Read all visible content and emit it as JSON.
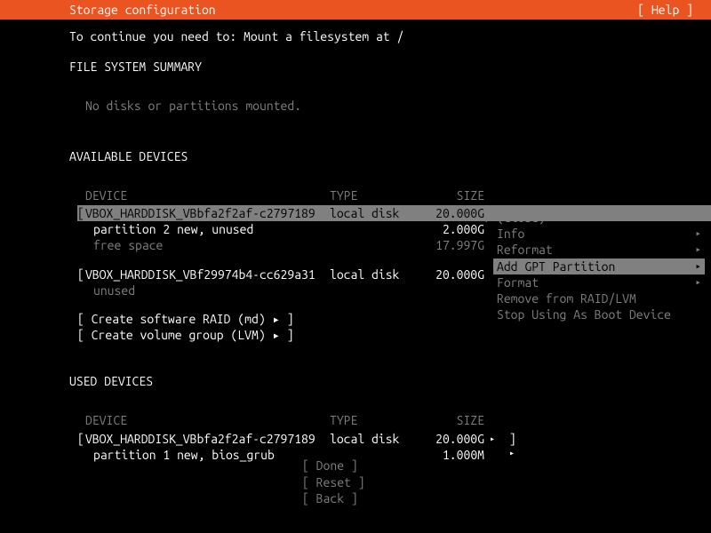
{
  "header": {
    "title": "Storage configuration",
    "help": "[ Help ]"
  },
  "instruction": "To continue you need to: Mount a filesystem at /",
  "fs_summary": {
    "title": "FILE SYSTEM SUMMARY",
    "empty": "No disks or partitions mounted."
  },
  "available": {
    "title": "AVAILABLE DEVICES",
    "cols": {
      "device": "DEVICE",
      "type": "TYPE",
      "size": "SIZE"
    },
    "d1": {
      "name": "VBOX_HARDDISK_VBbfa2f2af-c2797189",
      "type": "local disk",
      "size": "20.000G",
      "p1": {
        "label": "partition 2  new, unused",
        "size": "2.000G"
      },
      "p2": {
        "label": "free space",
        "size": "17.997G"
      }
    },
    "d2": {
      "name": "VBOX_HARDDISK_VBf29974b4-cc629a31",
      "type": "local disk",
      "size": "20.000G",
      "status": "unused"
    },
    "raid": "[ Create software RAID (md) ▸ ]",
    "lvm": "[ Create volume group (LVM) ▸ ]"
  },
  "used": {
    "title": "USED DEVICES",
    "cols": {
      "device": "DEVICE",
      "type": "TYPE",
      "size": "SIZE"
    },
    "d1": {
      "name": "VBOX_HARDDISK_VBbfa2f2af-c2797189",
      "type": "local disk",
      "size": "20.000G",
      "p1": {
        "label": "partition 1  new, bios_grub",
        "size": "1.000M"
      }
    }
  },
  "menu": {
    "close": "(close)",
    "info": "Info",
    "reformat": "Reformat",
    "add_gpt": "Add GPT Partition",
    "format": "Format",
    "remove": "Remove from RAID/LVM",
    "stop": "Stop Using As Boot Device"
  },
  "footer": {
    "done": "[ Done    ]",
    "reset": "[ Reset   ]",
    "back": "[ Back    ]"
  }
}
